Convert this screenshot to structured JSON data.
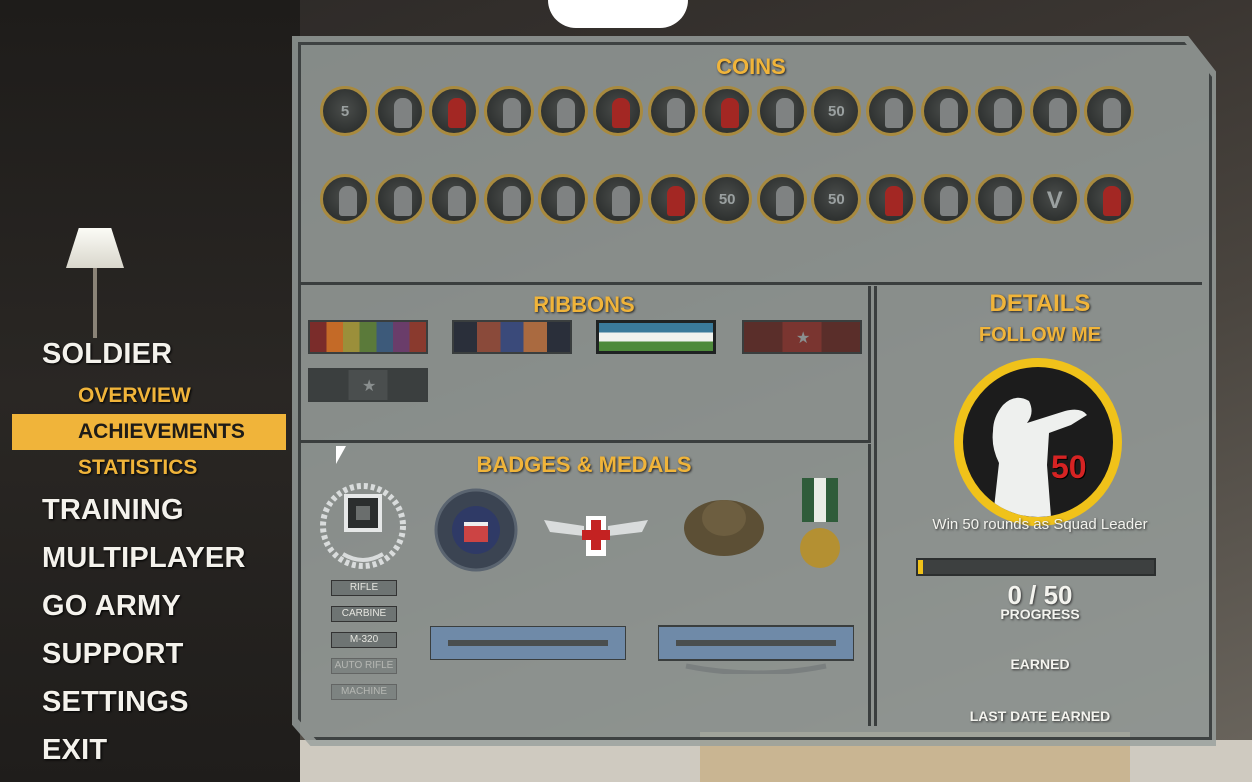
{
  "menu": {
    "items": [
      {
        "label": "SOLDIER",
        "sub": [
          {
            "label": "OVERVIEW",
            "active": false
          },
          {
            "label": "ACHIEVEMENTS",
            "active": true
          },
          {
            "label": "STATISTICS",
            "active": false
          }
        ]
      },
      {
        "label": "TRAINING"
      },
      {
        "label": "MULTIPLAYER"
      },
      {
        "label": "GO ARMY"
      },
      {
        "label": "SUPPORT"
      },
      {
        "label": "SETTINGS"
      },
      {
        "label": "EXIT"
      }
    ]
  },
  "sections": {
    "coins_title": "COINS",
    "ribbons_title": "RIBBONS",
    "badges_title": "BADGES & MEDALS",
    "details_title": "DETAILS"
  },
  "coins": {
    "row1": [
      "skull-5",
      "target",
      "grenade",
      "handshake",
      "soldier",
      "soldier-red",
      "squad",
      "fallen-soldier",
      "runner",
      "star-50",
      "soldier-crawl",
      "jumper",
      "crawler",
      "infinity",
      "sniper"
    ],
    "row2": [
      "eagle",
      "leader",
      "kneeler",
      "no-symbol",
      "rooster",
      "victory-arms",
      "red-cross",
      "flag-50",
      "runner-2",
      "50",
      "group-red",
      "map",
      "statue",
      "v",
      "figure-red"
    ],
    "text_50": "50",
    "text_v": "V",
    "text_5": "5"
  },
  "ribbons": [
    {
      "name": "multi-color-ribbon",
      "colors": [
        "#7a2c2a",
        "#c46a27",
        "#9b8f3a",
        "#5b7a3a",
        "#3d5a7a",
        "#6a3d6a",
        "#8a3a2e"
      ]
    },
    {
      "name": "navy-red-ribbon",
      "colors": [
        "#2a2f3a",
        "#8a4a3a",
        "#3a4a7a",
        "#aa6a40",
        "#2a2f3a"
      ]
    },
    {
      "name": "green-white-ribbon",
      "colors": [
        "#3a7a9a",
        "#f0f2ee",
        "#4d8a3a"
      ],
      "selected": true
    },
    {
      "name": "red-star-ribbon",
      "colors": [
        "#5a2e2a",
        "#7a3530",
        "#5a2e2a"
      ]
    },
    {
      "name": "gray-star-ribbon",
      "colors": [
        "#3b3f3f",
        "#4a4e4e",
        "#3b3f3f"
      ]
    }
  ],
  "badges": {
    "labels": [
      "RIFLE",
      "CARBINE",
      "M-320",
      "AUTO RIFLE",
      "MACHINE"
    ]
  },
  "details": {
    "title": "DETAILS",
    "achievement_name": "FOLLOW ME",
    "coin_number": "50",
    "description": "Win 50 rounds as Squad Leader",
    "progress_text": "0 / 50",
    "progress_label": "PROGRESS",
    "progress_value": 0,
    "progress_max": 50,
    "earned_label": "EARNED",
    "last_date_label": "LAST DATE EARNED"
  },
  "colors": {
    "accent": "#f0b43a",
    "coin_ring": "#f0c21a"
  }
}
